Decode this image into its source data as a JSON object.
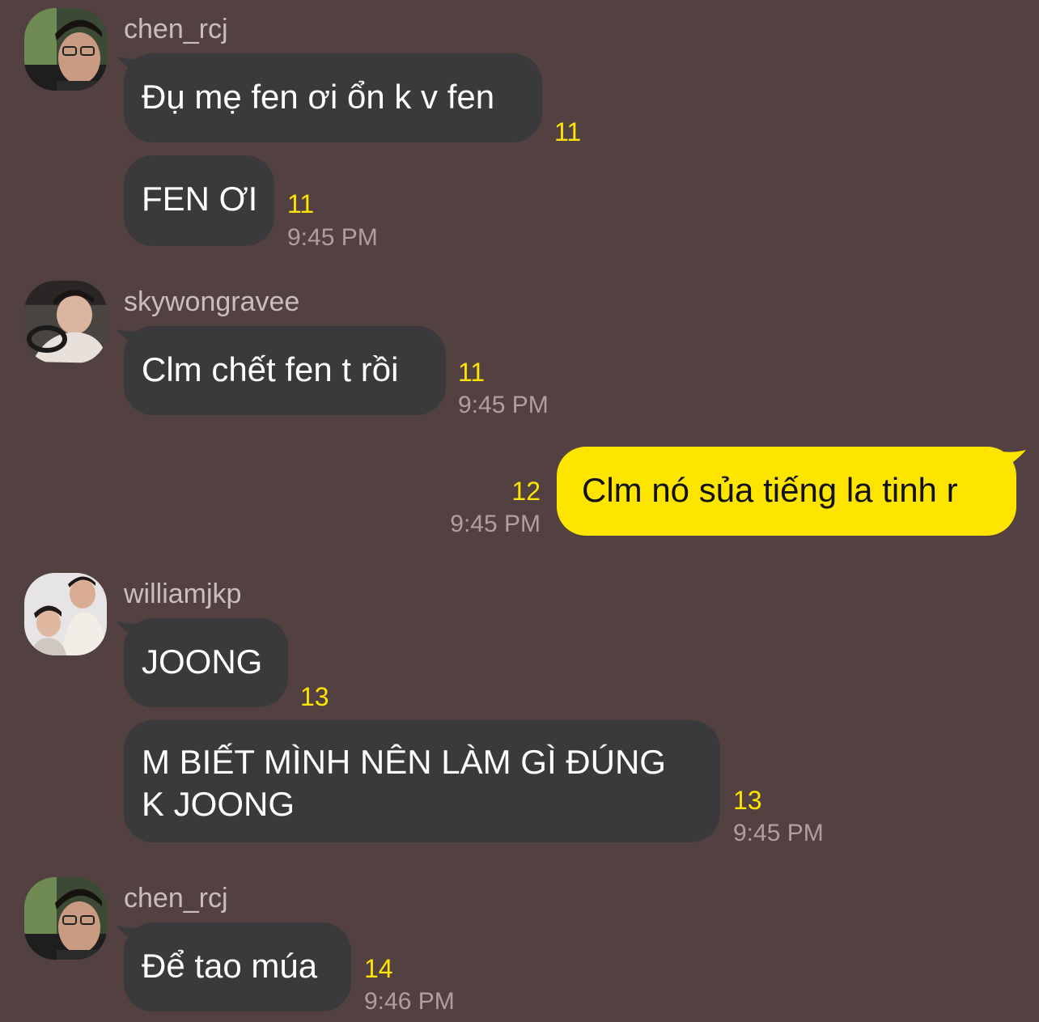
{
  "colors": {
    "background": "#534142",
    "bubble_other": "#3a3a3c",
    "bubble_mine": "#fee500",
    "unread_count": "#fde500",
    "timestamp": "#b09ea0",
    "sender_name": "#cbbcbd"
  },
  "messages": [
    {
      "sender": "chen_rcj",
      "avatar": "profile-photo",
      "bubbles": [
        {
          "text": "Đụ mẹ fen ơi ổn k v fen",
          "unread": "11"
        },
        {
          "text": "FEN ƠI",
          "unread": "11",
          "time": "9:45 PM"
        }
      ]
    },
    {
      "sender": "skywongravee",
      "avatar": "profile-photo",
      "bubbles": [
        {
          "text": "Clm chết fen t rồi",
          "unread": "11",
          "time": "9:45 PM"
        }
      ]
    },
    {
      "sender": "me",
      "bubbles": [
        {
          "text": "Clm nó sủa tiếng la tinh r",
          "unread": "12",
          "time": "9:45 PM"
        }
      ]
    },
    {
      "sender": "williamjkp",
      "avatar": "profile-photo",
      "bubbles": [
        {
          "text": "JOONG",
          "unread": "13"
        },
        {
          "line1": "M BIẾT MÌNH NÊN LÀM GÌ ĐÚNG",
          "line2": "K JOONG",
          "unread": "13",
          "time": "9:45 PM"
        }
      ]
    },
    {
      "sender": "chen_rcj",
      "avatar": "profile-photo",
      "bubbles": [
        {
          "text": "Để tao múa",
          "unread": "14",
          "time": "9:46 PM"
        }
      ]
    }
  ]
}
